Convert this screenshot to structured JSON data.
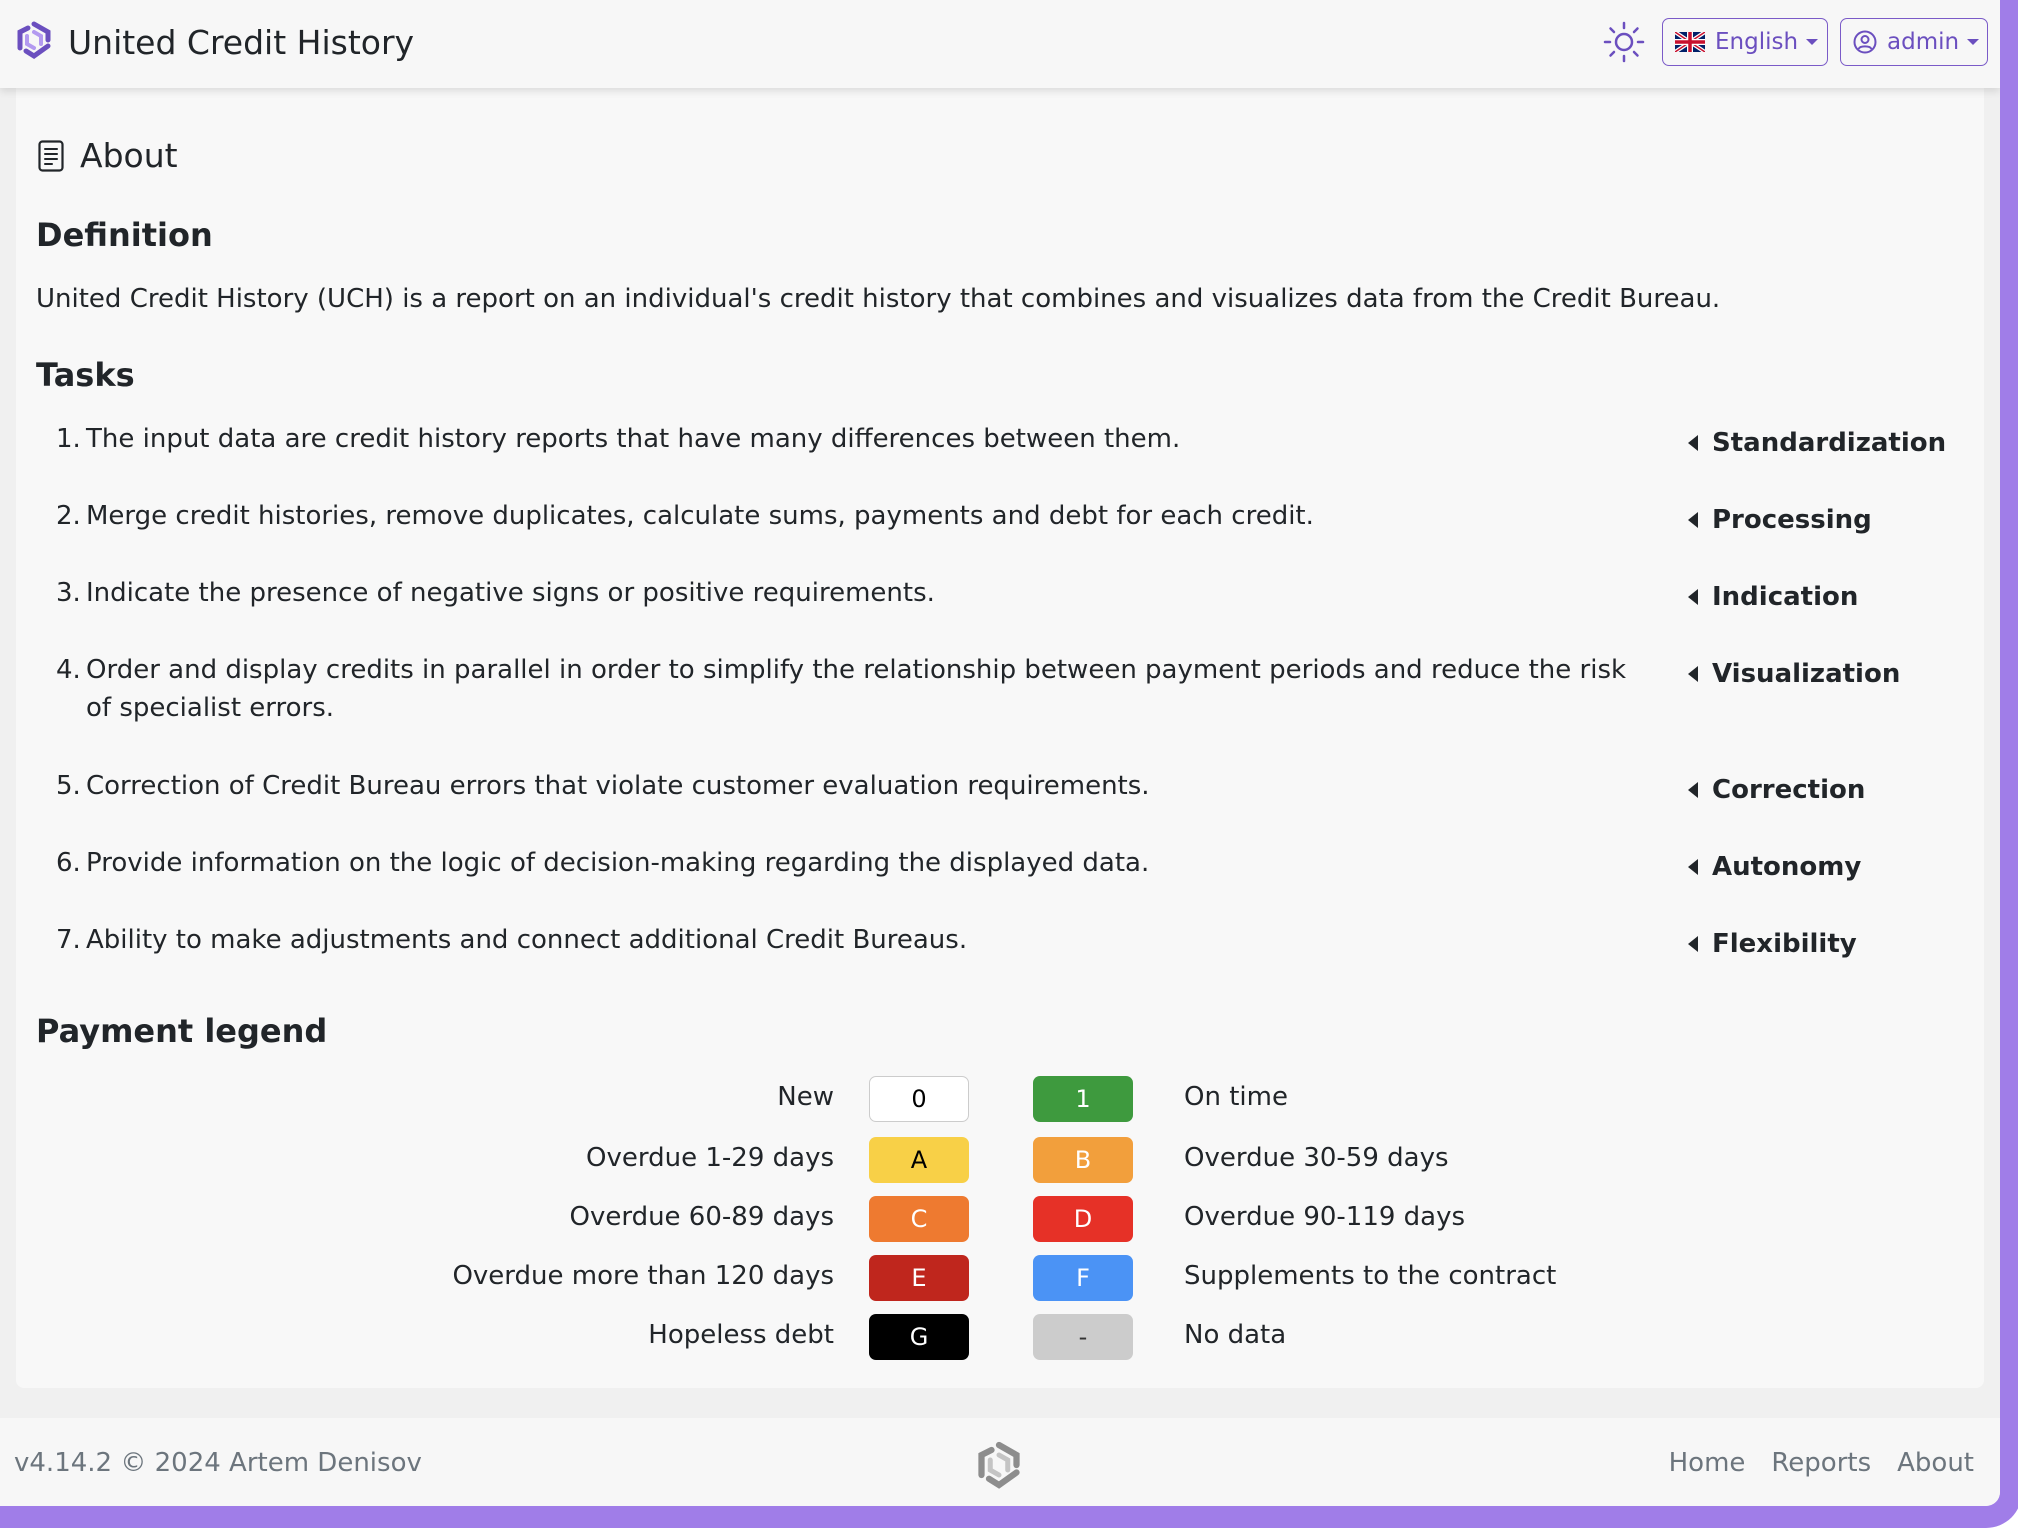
{
  "header": {
    "title": "United Credit History",
    "language": "English",
    "user": "admin"
  },
  "page": {
    "title": "About",
    "definition_heading": "Definition",
    "definition_text": "United Credit History (UCH) is a report on an individual's credit history that combines and visualizes data from the Credit Bureau.",
    "tasks_heading": "Tasks",
    "tasks": [
      {
        "num": "1.",
        "text": "The input data are credit history reports that have many differences between them.",
        "tag": "Standardization"
      },
      {
        "num": "2.",
        "text": "Merge credit histories, remove duplicates, calculate sums, payments and debt for each credit.",
        "tag": "Processing"
      },
      {
        "num": "3.",
        "text": "Indicate the presence of negative signs or positive requirements.",
        "tag": "Indication"
      },
      {
        "num": "4.",
        "text": "Order and display credits in parallel in order to simplify the relationship between payment periods and reduce the risk of specialist errors.",
        "tag": "Visualization"
      },
      {
        "num": "5.",
        "text": "Correction of Credit Bureau errors that violate customer evaluation requirements.",
        "tag": "Correction"
      },
      {
        "num": "6.",
        "text": "Provide information on the logic of decision-making regarding the displayed data.",
        "tag": "Autonomy"
      },
      {
        "num": "7.",
        "text": "Ability to make adjustments and connect additional Credit Bureaus.",
        "tag": "Flexibility"
      }
    ],
    "legend_heading": "Payment legend",
    "legend": [
      {
        "left_label": "New",
        "left_code": "0",
        "left_color": "#ffffff",
        "left_text_color": "#000000",
        "right_code": "1",
        "right_color": "#3e9a3e",
        "right_text_color": "#ffffff",
        "right_label": "On time"
      },
      {
        "left_label": "Overdue 1-29 days",
        "left_code": "A",
        "left_color": "#f8d047",
        "left_text_color": "#000000",
        "right_code": "B",
        "right_color": "#f29f3c",
        "right_text_color": "#ffffff",
        "right_label": "Overdue 30-59 days"
      },
      {
        "left_label": "Overdue 60-89 days",
        "left_code": "C",
        "left_color": "#ee7a30",
        "left_text_color": "#ffffff",
        "right_code": "D",
        "right_color": "#e63127",
        "right_text_color": "#ffffff",
        "right_label": "Overdue 90-119 days"
      },
      {
        "left_label": "Overdue more than 120 days",
        "left_code": "E",
        "left_color": "#bf261d",
        "left_text_color": "#ffffff",
        "right_code": "F",
        "right_color": "#4b93f5",
        "right_text_color": "#ffffff",
        "right_label": "Supplements to the contract"
      },
      {
        "left_label": "Hopeless debt",
        "left_code": "G",
        "left_color": "#000000",
        "left_text_color": "#ffffff",
        "right_code": "-",
        "right_color": "#cccccc",
        "right_text_color": "#333333",
        "right_label": "No data"
      }
    ]
  },
  "footer": {
    "version": "v4.14.2 © 2024 Artem Denisov",
    "nav": [
      "Home",
      "Reports",
      "About"
    ]
  },
  "colors": {
    "accent": "#6b4fbf",
    "frame": "#a07de8"
  },
  "icons": {
    "brand": "logo-icon",
    "theme": "sun-icon",
    "language": "uk-flag-icon",
    "user": "user-circle-icon",
    "page": "document-icon"
  }
}
